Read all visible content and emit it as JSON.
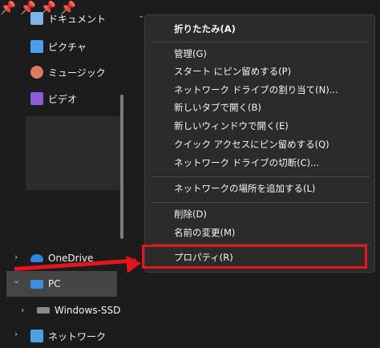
{
  "sidebar": {
    "quick": [
      {
        "label": "ドキュメント",
        "icon": "documents-icon",
        "color": "#7fb2e6"
      },
      {
        "label": "ピクチャ",
        "icon": "pictures-icon",
        "color": "#49a0e8"
      },
      {
        "label": "ミュージック",
        "icon": "music-icon",
        "color": "#e07a5f"
      },
      {
        "label": "ビデオ",
        "icon": "videos-icon",
        "color": "#8c5bd6"
      }
    ],
    "onedrive": "OneDrive",
    "pc": "PC",
    "drive": "Windows-SSD",
    "network": "ネットワーク",
    "pin_glyph": "📌",
    "chevron_right": "›",
    "chevron_down": "⌄"
  },
  "menu": {
    "collapse": "折りたたみ(A)",
    "manage": "管理(G)",
    "pin_start": "スタート にピン留めする(P)",
    "map_drive": "ネットワーク ドライブの割り当て(N)...",
    "open_new_tab": "新しいタブで開く(B)",
    "open_new_window": "新しいウィンドウで開く(E)",
    "pin_quick": "クイック アクセスにピン留めする(Q)",
    "disconnect_drive": "ネットワーク ドライブの切断(C)...",
    "add_network_location": "ネットワークの場所を追加する(L)",
    "delete": "削除(D)",
    "rename": "名前の変更(M)",
    "properties": "プロパティ(R)"
  },
  "colors": {
    "highlight": "#e8141c",
    "menu_bg": "#2b2b2b",
    "selected_row": "#454545"
  }
}
